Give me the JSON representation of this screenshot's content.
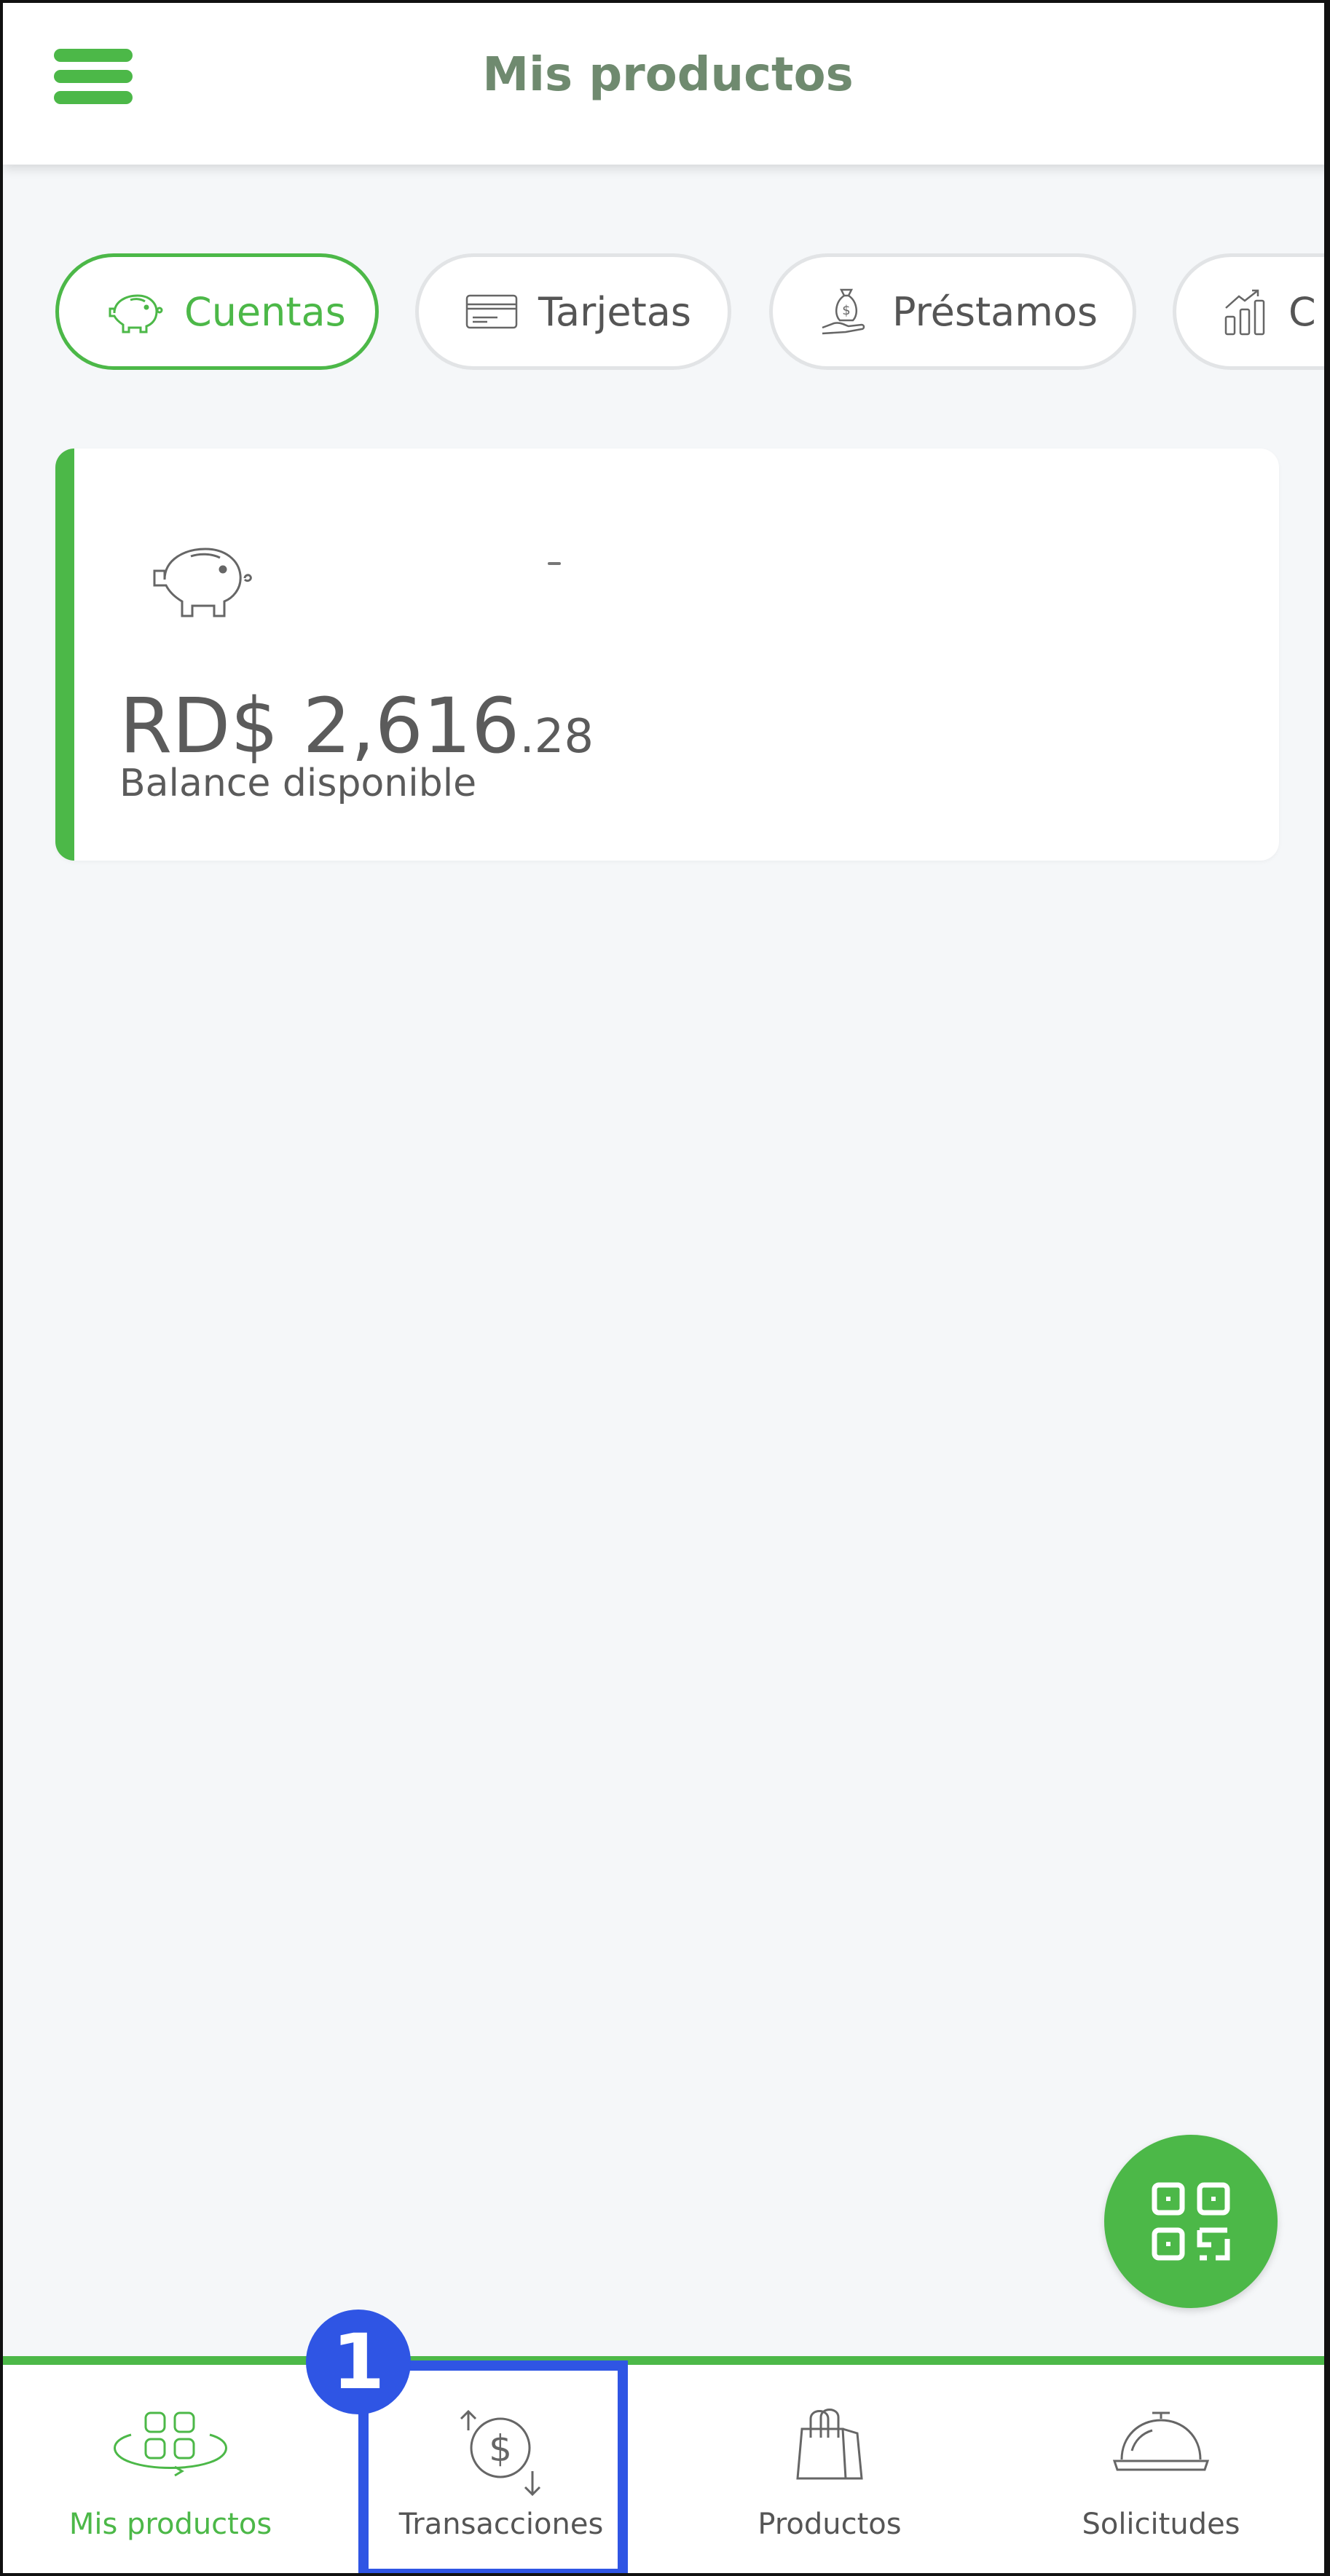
{
  "header": {
    "title": "Mis productos",
    "menu_icon": "hamburger-menu-icon"
  },
  "chips": [
    {
      "label": "Cuentas",
      "icon": "piggy-bank-icon",
      "active": true
    },
    {
      "label": "Tarjetas",
      "icon": "credit-card-icon",
      "active": false
    },
    {
      "label": "Préstamos",
      "icon": "money-bag-hand-icon",
      "active": false
    },
    {
      "label": "C",
      "icon": "growth-chart-icon",
      "active": false
    }
  ],
  "account": {
    "icon": "piggy-bank-icon",
    "balance_main": "RD$ 2,616",
    "balance_cents": ".28",
    "balance_label": "Balance disponible"
  },
  "fab": {
    "icon": "qr-scan-icon"
  },
  "bottom_nav": [
    {
      "label": "Mis productos",
      "icon": "grid-products-icon",
      "active": true
    },
    {
      "label": "Transacciones",
      "icon": "dollar-transfer-icon",
      "active": false
    },
    {
      "label": "Productos",
      "icon": "shopping-bag-icon",
      "active": false
    },
    {
      "label": "Solicitudes",
      "icon": "service-bell-icon",
      "active": false
    }
  ],
  "annotation": {
    "badge_number": "1"
  },
  "colors": {
    "brand_green": "#4cb848",
    "title_green": "#6f8a6f",
    "annotation_blue": "#2f55e4",
    "background": "#f5f7f9"
  }
}
